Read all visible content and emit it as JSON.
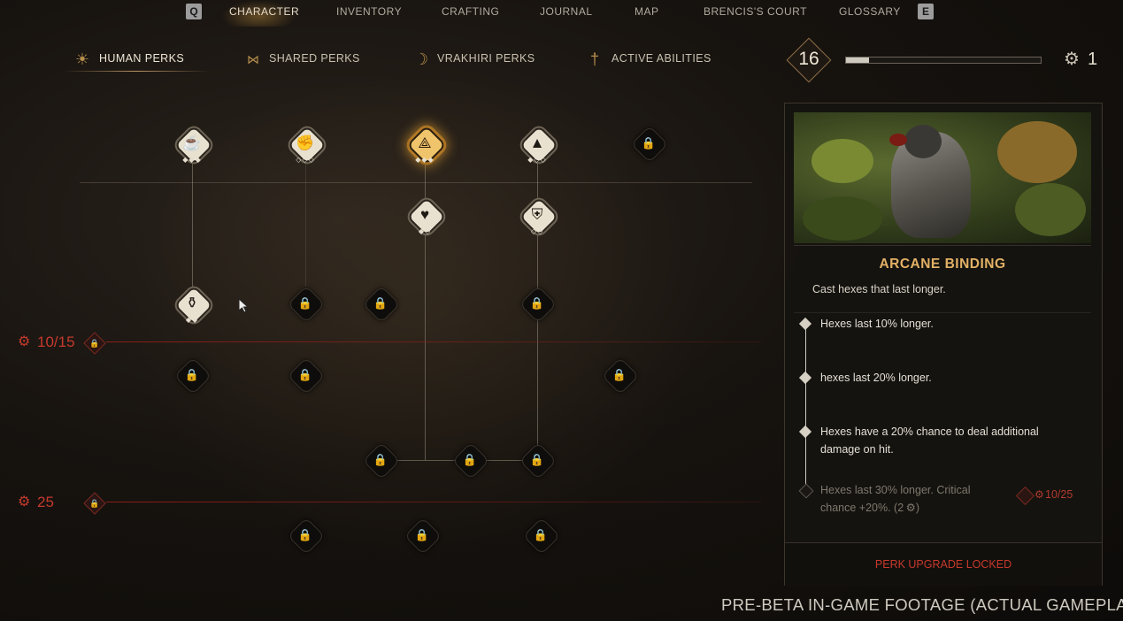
{
  "nav": {
    "left_key": "Q",
    "right_key": "E",
    "tabs": [
      "CHARACTER",
      "INVENTORY",
      "CRAFTING",
      "JOURNAL",
      "MAP",
      "BRENCIS'S COURT",
      "GLOSSARY"
    ],
    "active": "CHARACTER"
  },
  "subtabs": [
    {
      "label": "HUMAN PERKS",
      "icon": "sun-icon"
    },
    {
      "label": "SHARED PERKS",
      "icon": "bowtie-icon"
    },
    {
      "label": "VRAKHIRI PERKS",
      "icon": "moon-icon"
    },
    {
      "label": "ACTIVE ABILITIES",
      "icon": "dagger-icon"
    }
  ],
  "active_subtab": "HUMAN PERKS",
  "level": {
    "value": "16",
    "xp_fraction": 0.12
  },
  "perk_points": {
    "icon": "gear-icon",
    "value": "1"
  },
  "gates": [
    {
      "label": "10/15",
      "icon": "gear-icon"
    },
    {
      "label": "25",
      "icon": "gear-icon"
    }
  ],
  "tree_nodes": [
    {
      "name": "mug-perk",
      "glyph": "mug-icon",
      "state": "unlocked",
      "pips": "◆◆◆"
    },
    {
      "name": "fist-perk",
      "glyph": "fist-icon",
      "state": "unlocked",
      "pips": "◇◇◇"
    },
    {
      "name": "arcane-binding-perk",
      "glyph": "triangle-rune-icon",
      "state": "selected",
      "pips": "◆◆◆"
    },
    {
      "name": "triangle-perk",
      "glyph": "triangle-icon",
      "state": "unlocked",
      "pips": "◆◇◇"
    },
    {
      "name": "locked-perk-r1c5",
      "glyph": "lock-icon",
      "state": "locked",
      "pips": ""
    },
    {
      "name": "heart-perk",
      "glyph": "heart-icon",
      "state": "unlocked",
      "pips": "◆◇"
    },
    {
      "name": "shield-perk",
      "glyph": "shield-icon",
      "state": "unlocked",
      "pips": "◇◇"
    },
    {
      "name": "teapot-perk",
      "glyph": "teapot-icon",
      "state": "unlocked",
      "pips": "◆◆"
    },
    {
      "name": "locked-perk-r3c2",
      "glyph": "lock-icon",
      "state": "locked",
      "pips": ""
    },
    {
      "name": "locked-perk-r3c3",
      "glyph": "lock-icon",
      "state": "locked",
      "pips": ""
    },
    {
      "name": "locked-perk-r3c4",
      "glyph": "lock-icon",
      "state": "locked",
      "pips": ""
    },
    {
      "name": "locked-perk-r4c1",
      "glyph": "lock-icon",
      "state": "locked",
      "pips": ""
    },
    {
      "name": "locked-perk-r4c2",
      "glyph": "lock-icon",
      "state": "locked",
      "pips": ""
    },
    {
      "name": "locked-perk-r4c5",
      "glyph": "lock-icon",
      "state": "locked",
      "pips": ""
    },
    {
      "name": "locked-perk-r5c3",
      "glyph": "lock-icon",
      "state": "locked",
      "pips": ""
    },
    {
      "name": "locked-perk-r5c4",
      "glyph": "lock-icon",
      "state": "locked",
      "pips": ""
    },
    {
      "name": "locked-perk-r5c5",
      "glyph": "lock-icon",
      "state": "locked",
      "pips": ""
    },
    {
      "name": "locked-perk-r6c2",
      "glyph": "lock-icon",
      "state": "locked",
      "pips": ""
    },
    {
      "name": "locked-perk-r6c3",
      "glyph": "lock-icon",
      "state": "locked",
      "pips": ""
    },
    {
      "name": "locked-perk-r6c4",
      "glyph": "lock-icon",
      "state": "locked",
      "pips": ""
    }
  ],
  "detail": {
    "title": "ARCANE BINDING",
    "description": "Cast hexes that last longer.",
    "tiers": [
      {
        "text": "Hexes last 10% longer.",
        "unlocked": true
      },
      {
        "text": "hexes last 20% longer.",
        "unlocked": true
      },
      {
        "text": "Hexes have a 20% chance to deal additional damage on hit.",
        "unlocked": true
      },
      {
        "text": "Hexes last 30% longer. Critical chance +20%. (2 ⚙)",
        "unlocked": false
      }
    ],
    "requirement": "10/25",
    "locked_label": "PERK UPGRADE LOCKED"
  },
  "footer_text": "PRE-BETA IN-GAME FOOTAGE (ACTUAL GAMEPLAY)",
  "colors": {
    "accent_gold": "#e3b165",
    "locked_red": "#c7392c",
    "selected_glow": "#f0c46a"
  }
}
